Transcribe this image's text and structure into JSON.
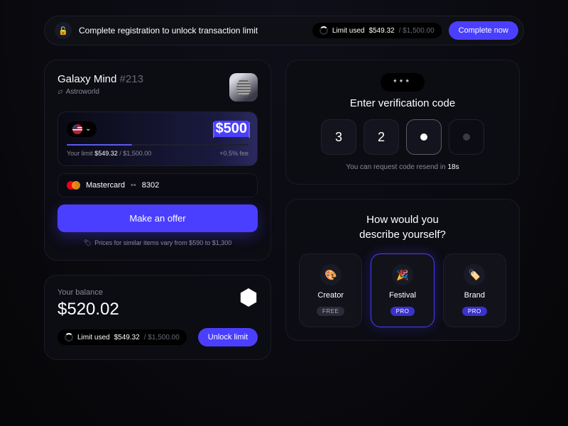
{
  "banner": {
    "text": "Complete registration to unlock transaction limit",
    "limit_label": "Limit used",
    "limit_used": "$549.32",
    "limit_total": "/ $1,500.00",
    "cta": "Complete now"
  },
  "offer": {
    "title": "Galaxy Mind",
    "number": "#213",
    "collection": "Astroworld",
    "amount": "$500",
    "limit_label": "Your limit",
    "limit_used": "$549.32",
    "limit_total": "/ $1,500.00",
    "fee": "+0.5% fee",
    "card_brand": "Mastercard",
    "card_dots": "••",
    "card_last4": "8302",
    "cta": "Make an offer",
    "hint": "Prices for similar items vary from $590 to $1,300"
  },
  "balance": {
    "label": "Your balance",
    "value": "$520.02",
    "limit_label": "Limit used",
    "limit_used": "$549.32",
    "limit_total": "/ $1,500.00",
    "cta": "Unlock limit"
  },
  "verify": {
    "mask": "***",
    "title": "Enter verification code",
    "digits": [
      "3",
      "2"
    ],
    "resend_prefix": "You can request code resend in ",
    "resend_time": "18s"
  },
  "describe": {
    "title_line1": "How would you",
    "title_line2": "describe yourself?",
    "options": [
      {
        "emoji": "🎨",
        "label": "Creator",
        "badge": "FREE",
        "badge_type": "free"
      },
      {
        "emoji": "🎉",
        "label": "Festival",
        "badge": "PRO",
        "badge_type": "pro"
      },
      {
        "emoji": "🏷️",
        "label": "Brand",
        "badge": "PRO",
        "badge_type": "pro"
      }
    ]
  }
}
